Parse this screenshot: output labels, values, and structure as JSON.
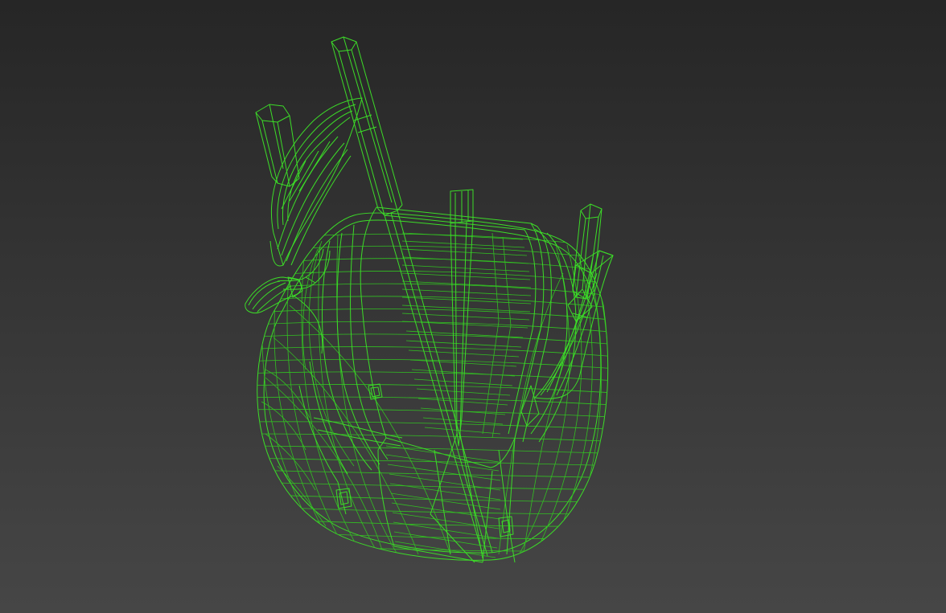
{
  "viewport": {
    "background_top": "#262626",
    "background_bottom": "#464646",
    "wire_color": "#3cdc28",
    "render_mode": "wireframe"
  }
}
